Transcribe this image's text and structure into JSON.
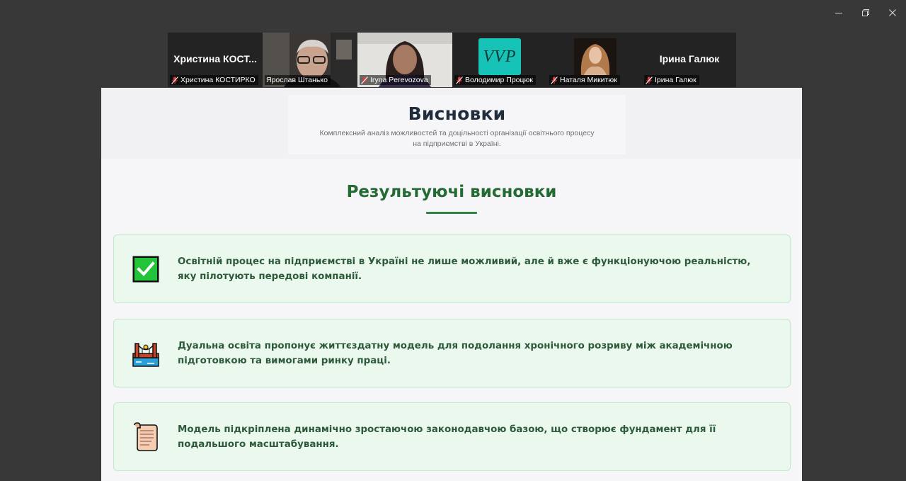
{
  "participants": [
    {
      "display_name": "Христина  КОСТ...",
      "label": "Христина КОСТИРКО",
      "kind": "name"
    },
    {
      "display_name": "",
      "label": "Ярослав Штанько",
      "kind": "video-man",
      "active": true
    },
    {
      "display_name": "",
      "label": "Iryna Perevozova",
      "kind": "video-woman"
    },
    {
      "display_name": "VVP",
      "label": "Володимир Процюк",
      "kind": "logo"
    },
    {
      "display_name": "",
      "label": "Наталя Микитюк",
      "kind": "photo"
    },
    {
      "display_name": "Ірина Галюк",
      "label": "Ірина Галюк",
      "kind": "name"
    }
  ],
  "slide": {
    "title": "Висновки",
    "subtitle_line1": "Комплексний аналіз можливостей та доцільності організації освітнього процесу",
    "subtitle_line2": "на підприємстві в Україні.",
    "section_title": "Результуючі висновки",
    "cards": [
      {
        "icon": "check-mark-icon",
        "text": "Освітній процес на підприємстві в Україні не лише можливий, але й вже є функціонуючою реальністю, яку пілотують передові компанії."
      },
      {
        "icon": "bridge-icon",
        "text": "Дуальна освіта пропонує життєздатну модель для подолання хронічного розриву між академічною підготовкою та вимогами ринку праці."
      },
      {
        "icon": "scroll-icon",
        "text": "Модель підкріплена динамічно зростаючою законодавчою базою, що створює фундамент для її подальшого масштабування."
      }
    ]
  },
  "colors": {
    "accent_green": "#2e8540",
    "section_title": "#236a33",
    "card_bg": "#ebf8ee",
    "card_border": "#bfe9c9",
    "active_speaker": "#2bd36a"
  }
}
